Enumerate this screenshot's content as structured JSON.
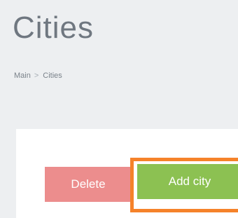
{
  "page": {
    "title": "Cities"
  },
  "breadcrumb": {
    "items": [
      "Main",
      "Cities"
    ],
    "separator": ">"
  },
  "actions": {
    "delete_label": "Delete",
    "add_label": "Add city",
    "delete_color": "#ec8d8d",
    "add_color": "#8cc152",
    "highlight_color": "#f5822a"
  }
}
